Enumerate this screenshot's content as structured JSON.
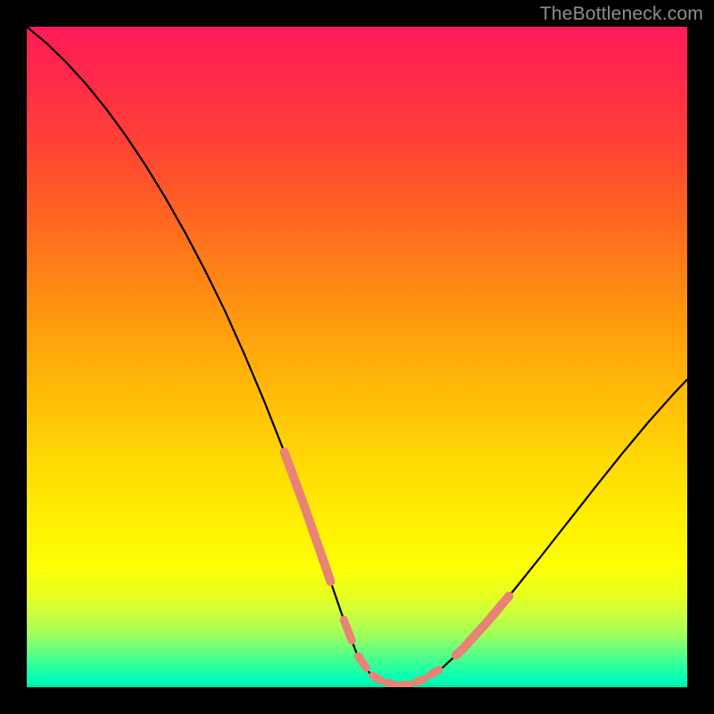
{
  "watermark": "TheBottleneck.com",
  "colors": {
    "black": "#000000",
    "curve": "#000000",
    "salmon": "#e88376",
    "watermark": "#8f8f8f"
  },
  "chart_data": {
    "type": "line",
    "title": "",
    "xlabel": "",
    "ylabel": "",
    "xlim": [
      0,
      100
    ],
    "ylim": [
      0,
      100
    ],
    "grid": false,
    "legend": false,
    "series": [
      {
        "name": "curve",
        "x": [
          0,
          3,
          6,
          9,
          12,
          15,
          18,
          21,
          24,
          27,
          30,
          33,
          36,
          39,
          42,
          45,
          48,
          50,
          52,
          54,
          56,
          58,
          60,
          63,
          66,
          70,
          74,
          78,
          82,
          86,
          90,
          94,
          98,
          100
        ],
        "y": [
          100,
          97.5,
          94.6,
          91.3,
          87.6,
          83.5,
          79.0,
          74.1,
          68.8,
          63.1,
          57.0,
          50.3,
          43.2,
          35.6,
          27.5,
          18.9,
          10.2,
          5.0,
          2.0,
          0.8,
          0.3,
          0.4,
          1.2,
          3.0,
          5.8,
          10.2,
          15.0,
          20.0,
          25.1,
          30.2,
          35.2,
          40.0,
          44.5,
          46.6
        ]
      }
    ],
    "salmon_segments": [
      {
        "x_range": [
          39,
          46
        ],
        "note": "thick salmon overlay on left descent near bottom"
      },
      {
        "x_range": [
          48,
          62
        ],
        "note": "dotted salmon segments across valley floor"
      },
      {
        "x_range": [
          65,
          73
        ],
        "note": "thick salmon overlay on right ascent"
      }
    ],
    "background_gradient": {
      "type": "vertical",
      "stops": [
        {
          "pos": 0.0,
          "color": "#ff1a58"
        },
        {
          "pos": 0.3,
          "color": "#ff6a1f"
        },
        {
          "pos": 0.64,
          "color": "#ffd405"
        },
        {
          "pos": 0.82,
          "color": "#fcff07"
        },
        {
          "pos": 0.96,
          "color": "#40ff94"
        },
        {
          "pos": 1.0,
          "color": "#00e0a2"
        }
      ]
    }
  }
}
